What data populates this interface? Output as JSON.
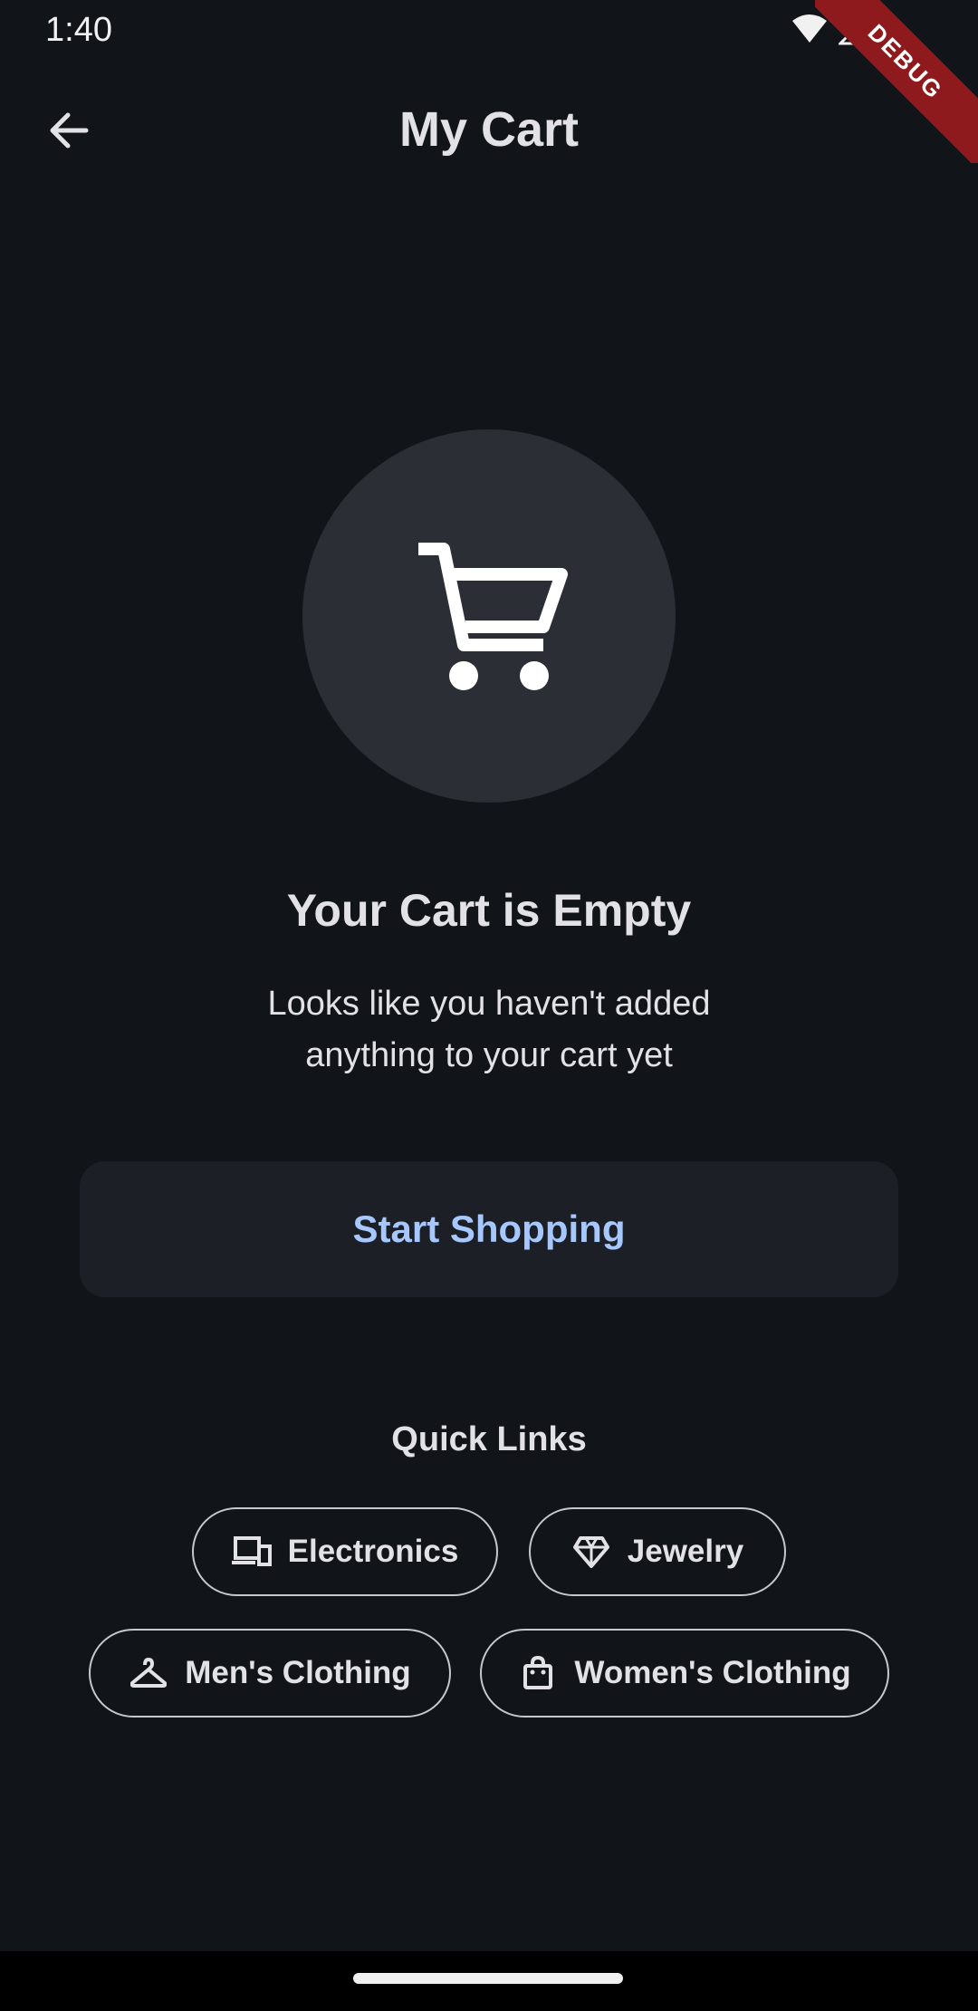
{
  "status_bar": {
    "time": "1:40",
    "icons": [
      "wifi-icon",
      "cell-signal-icon"
    ]
  },
  "debug_banner": {
    "label": "DEBUG",
    "color": "#8e1a1e"
  },
  "app_bar": {
    "title": "My Cart",
    "back_icon": "arrow-back-icon"
  },
  "empty_state": {
    "icon": "shopping-cart-icon",
    "title": "Your Cart is Empty",
    "subtitle_line1": "Looks like you haven't added",
    "subtitle_line2": "anything to your cart yet",
    "button_label": "Start Shopping"
  },
  "quick_links": {
    "title": "Quick Links",
    "items": [
      {
        "label": "Electronics",
        "icon": "devices-icon"
      },
      {
        "label": "Jewelry",
        "icon": "diamond-icon"
      },
      {
        "label": "Men's Clothing",
        "icon": "hanger-icon"
      },
      {
        "label": "Women's Clothing",
        "icon": "shopping-bag-icon"
      }
    ]
  },
  "colors": {
    "background": "#111418",
    "accent": "#a7c8ff",
    "surface": "#2b2f35",
    "button_surface": "#1c1f25"
  }
}
